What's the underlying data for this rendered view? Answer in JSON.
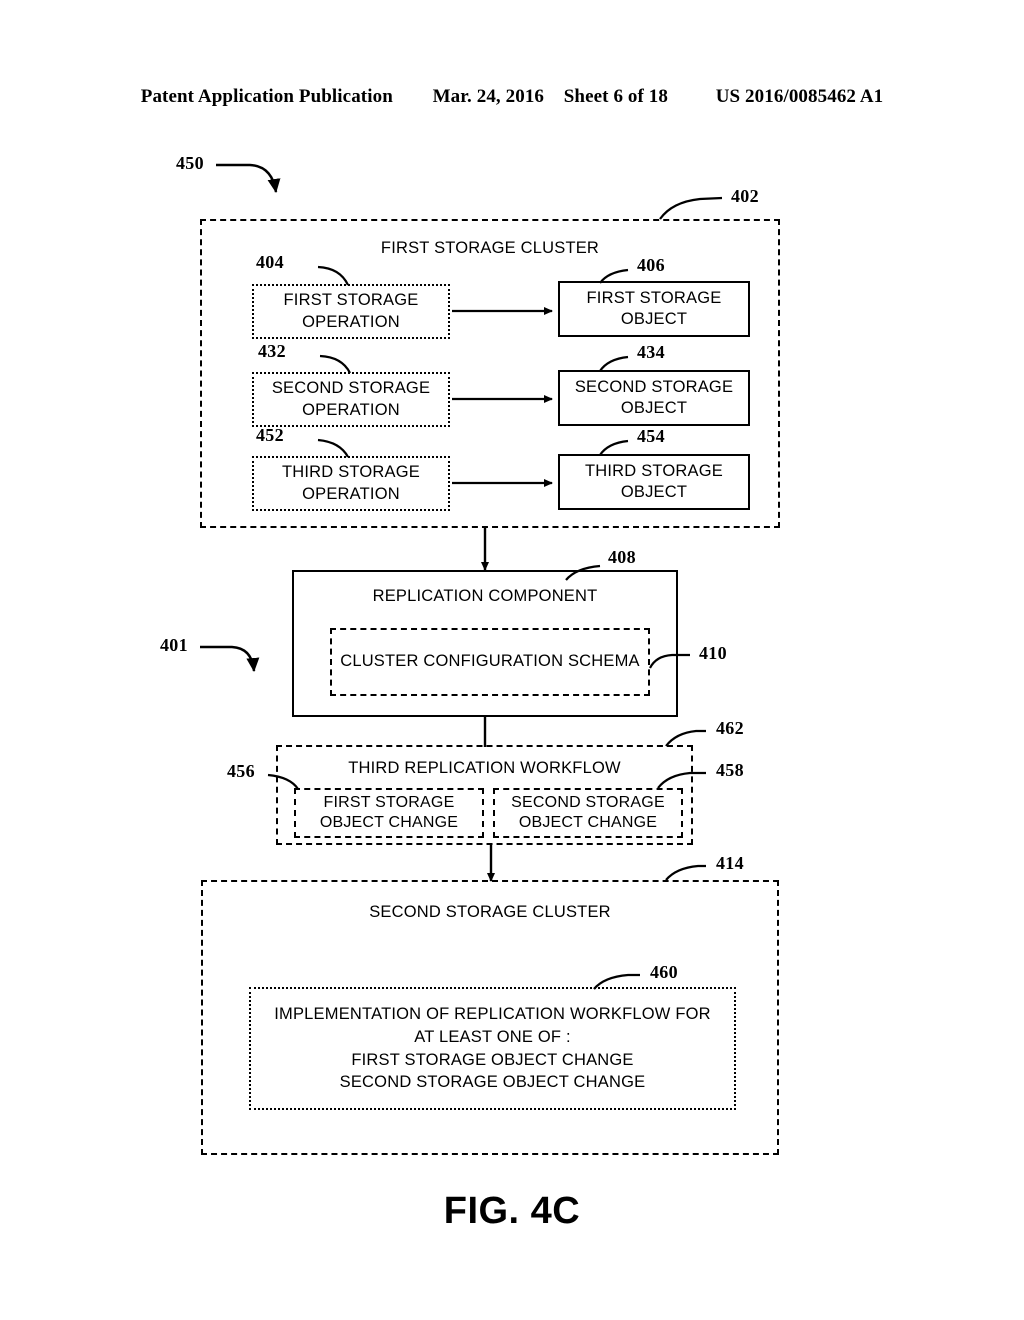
{
  "header": {
    "publication": "Patent Application Publication",
    "date": "Mar. 24, 2016",
    "sheet": "Sheet 6 of 18",
    "patent_number": "US 2016/0085462 A1"
  },
  "figure": {
    "caption": "FIG. 4C",
    "diagram_ref": "450",
    "system_ref": "401"
  },
  "first_cluster": {
    "ref": "402",
    "title": "FIRST STORAGE CLUSTER",
    "rows": [
      {
        "operation": {
          "ref": "404",
          "label": "FIRST STORAGE OPERATION"
        },
        "object": {
          "ref": "406",
          "label": "FIRST STORAGE OBJECT"
        }
      },
      {
        "operation": {
          "ref": "432",
          "label": "SECOND STORAGE OPERATION"
        },
        "object": {
          "ref": "434",
          "label": "SECOND STORAGE OBJECT"
        }
      },
      {
        "operation": {
          "ref": "452",
          "label": "THIRD STORAGE OPERATION"
        },
        "object": {
          "ref": "454",
          "label": "THIRD STORAGE OBJECT"
        }
      }
    ]
  },
  "replication_component": {
    "ref": "408",
    "title": "REPLICATION COMPONENT",
    "schema": {
      "ref": "410",
      "label": "CLUSTER CONFIGURATION SCHEMA"
    }
  },
  "replication_workflow": {
    "ref": "462",
    "title": "THIRD REPLICATION WORKFLOW",
    "changes": [
      {
        "ref": "456",
        "label": "FIRST STORAGE OBJECT CHANGE"
      },
      {
        "ref": "458",
        "label": "SECOND STORAGE OBJECT CHANGE"
      }
    ]
  },
  "second_cluster": {
    "ref": "414",
    "title": "SECOND STORAGE CLUSTER",
    "implementation": {
      "ref": "460",
      "line1": "IMPLEMENTATION OF REPLICATION WORKFLOW FOR",
      "line2": "AT LEAST ONE OF :",
      "line3": "FIRST STORAGE OBJECT CHANGE",
      "line4": "SECOND STORAGE OBJECT CHANGE"
    }
  }
}
